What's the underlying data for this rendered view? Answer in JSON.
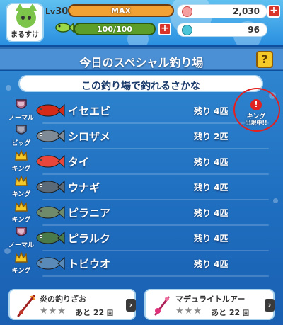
{
  "player": {
    "name": "まるすけ",
    "level_prefix": "Lv",
    "level": "30",
    "exp_label": "MAX",
    "stamina": "100/100"
  },
  "currencies": [
    {
      "icon": "shell-icon",
      "value": "2,030"
    },
    {
      "icon": "gem-icon",
      "value": "96"
    }
  ],
  "header": {
    "title": "今日のスペシャル釣り場",
    "help_label": "?"
  },
  "subheading": "この釣り場で釣れるさかな",
  "fish": [
    {
      "rank": "ノーマル",
      "rank_icon": "normal-badge",
      "name": "イセエビ",
      "remaining": "残り 4匹",
      "color": "#d32a1a"
    },
    {
      "rank": "ビッグ",
      "rank_icon": "big-badge",
      "name": "シロザメ",
      "remaining": "残り 2匹",
      "color": "#7e8a96"
    },
    {
      "rank": "キング",
      "rank_icon": "crown-icon",
      "name": "タイ",
      "remaining": "残り 4匹",
      "color": "#e8463a"
    },
    {
      "rank": "キング",
      "rank_icon": "crown-icon",
      "name": "ウナギ",
      "remaining": "残り 4匹",
      "color": "#5a6a78"
    },
    {
      "rank": "キング",
      "rank_icon": "crown-icon",
      "name": "ピラニア",
      "remaining": "残り 4匹",
      "color": "#6e8a6a"
    },
    {
      "rank": "ノーマル",
      "rank_icon": "normal-badge",
      "name": "ピラルク",
      "remaining": "残り 4匹",
      "color": "#4a7a4a"
    },
    {
      "rank": "キング",
      "rank_icon": "crown-icon",
      "name": "トビウオ",
      "remaining": "残り 4匹",
      "color": "#5a8ab8"
    }
  ],
  "king_notice": {
    "line1": "キング",
    "line2": "出現中!!",
    "mark": "!"
  },
  "items": [
    {
      "name": "炎の釣りざお",
      "stars": "★★★",
      "remaining_prefix": "あと",
      "remaining": "22",
      "unit": "回"
    },
    {
      "name": "マデュライトルアー",
      "stars": "★★★",
      "remaining_prefix": "あと",
      "remaining": "22",
      "unit": "回"
    }
  ],
  "colors": {
    "accent": "#f5c928",
    "ocean": "#1f6fc0",
    "king_alert": "#e02222"
  }
}
